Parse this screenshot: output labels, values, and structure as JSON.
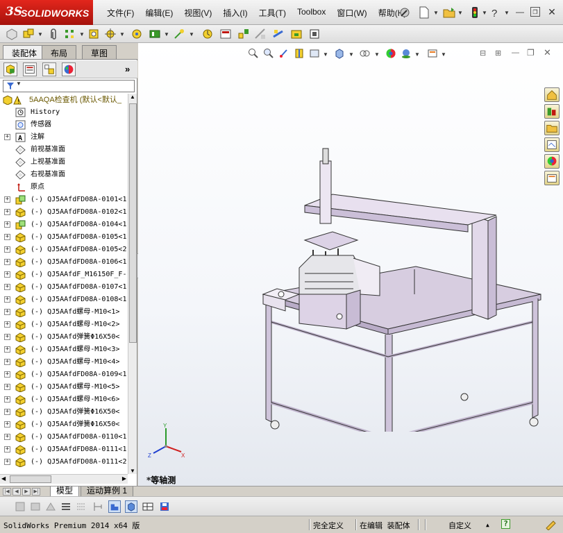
{
  "app": {
    "brand_ds": "3S",
    "brand_name": "SOLIDWORKS"
  },
  "menus": [
    "文件(F)",
    "编辑(E)",
    "视图(V)",
    "插入(I)",
    "工具(T)",
    "Toolbox",
    "窗口(W)",
    "帮助(H)"
  ],
  "panel": {
    "tabs": [
      "装配体",
      "布局",
      "草图"
    ],
    "expand_label": "»",
    "tree": [
      {
        "text": "5AAQA检查机  (默认<默认_",
        "icon": "assembly-warning-icon",
        "expand": "",
        "kind": "root"
      },
      {
        "text": "History",
        "icon": "history-icon",
        "expand": ""
      },
      {
        "text": "传感器",
        "icon": "sensor-icon",
        "expand": ""
      },
      {
        "text": "注解",
        "icon": "annotation-icon",
        "expand": "+"
      },
      {
        "text": "前视基准面",
        "icon": "plane-icon",
        "expand": ""
      },
      {
        "text": "上视基准面",
        "icon": "plane-icon",
        "expand": ""
      },
      {
        "text": "右视基准面",
        "icon": "plane-icon",
        "expand": ""
      },
      {
        "text": "原点",
        "icon": "origin-icon",
        "expand": ""
      },
      {
        "text": "(-) QJ5AAfdFD08A-0101<1",
        "icon": "subassembly-icon",
        "expand": "+"
      },
      {
        "text": "(-) QJ5AAfdFD08A-0102<1",
        "icon": "part-icon",
        "expand": "+"
      },
      {
        "text": "(-) QJ5AAfdFD08A-0104<1",
        "icon": "subassembly-icon",
        "expand": "+"
      },
      {
        "text": "(-) QJ5AAfdFD08A-0105<1",
        "icon": "part-icon",
        "expand": "+"
      },
      {
        "text": "(-) QJ5AAfdFD08A-0105<2",
        "icon": "part-icon",
        "expand": "+"
      },
      {
        "text": "(-) QJ5AAfdFD08A-0106<1",
        "icon": "part-icon",
        "expand": "+"
      },
      {
        "text": "(-) QJ5AAfdF_M16150F_F-",
        "icon": "part-icon",
        "expand": "+"
      },
      {
        "text": "(-) QJ5AAfdFD08A-0107<1",
        "icon": "part-icon",
        "expand": "+"
      },
      {
        "text": "(-) QJ5AAfdFD08A-0108<1",
        "icon": "part-icon",
        "expand": "+"
      },
      {
        "text": "(-) QJ5AAfd螺母-M10<1>",
        "icon": "part-icon",
        "expand": "+"
      },
      {
        "text": "(-) QJ5AAfd螺母-M10<2>",
        "icon": "part-icon",
        "expand": "+"
      },
      {
        "text": "(-) QJ5AAfd弹簧Φ16X50<",
        "icon": "part-icon",
        "expand": "+"
      },
      {
        "text": "(-) QJ5AAfd螺母-M10<3>",
        "icon": "part-icon",
        "expand": "+"
      },
      {
        "text": "(-) QJ5AAfd螺母-M10<4>",
        "icon": "part-icon",
        "expand": "+"
      },
      {
        "text": "(-) QJ5AAfdFD08A-0109<1",
        "icon": "part-icon",
        "expand": "+"
      },
      {
        "text": "(-) QJ5AAfd螺母-M10<5>",
        "icon": "part-icon",
        "expand": "+"
      },
      {
        "text": "(-) QJ5AAfd螺母-M10<6>",
        "icon": "part-icon",
        "expand": "+"
      },
      {
        "text": "(-) QJ5AAfd弹簧Φ16X50<",
        "icon": "part-icon",
        "expand": "+"
      },
      {
        "text": "(-) QJ5AAfd弹簧Φ16X50<",
        "icon": "part-icon",
        "expand": "+"
      },
      {
        "text": "(-) QJ5AAfdFD08A-0110<1",
        "icon": "part-icon",
        "expand": "+"
      },
      {
        "text": "(-) QJ5AAfdFD08A-0111<1",
        "icon": "part-icon",
        "expand": "+"
      },
      {
        "text": "(-) QJ5AAfdFD08A-0111<2",
        "icon": "part-icon",
        "expand": "+"
      }
    ]
  },
  "graphics": {
    "view_label": "*等轴测",
    "triad": {
      "x": "X",
      "y": "Y",
      "z": "Z"
    }
  },
  "bottom_tabs": [
    "模型",
    "运动算例 1"
  ],
  "status": {
    "product": "SolidWorks Premium 2014 x64 版",
    "definition": "完全定义",
    "editing": "在编辑 装配体",
    "units": "自定义",
    "units_caret": "▲",
    "help": "?"
  },
  "colors": {
    "accent_red": "#c0180f",
    "model_lilac": "#d7cde0",
    "tree_text": "#000000"
  }
}
